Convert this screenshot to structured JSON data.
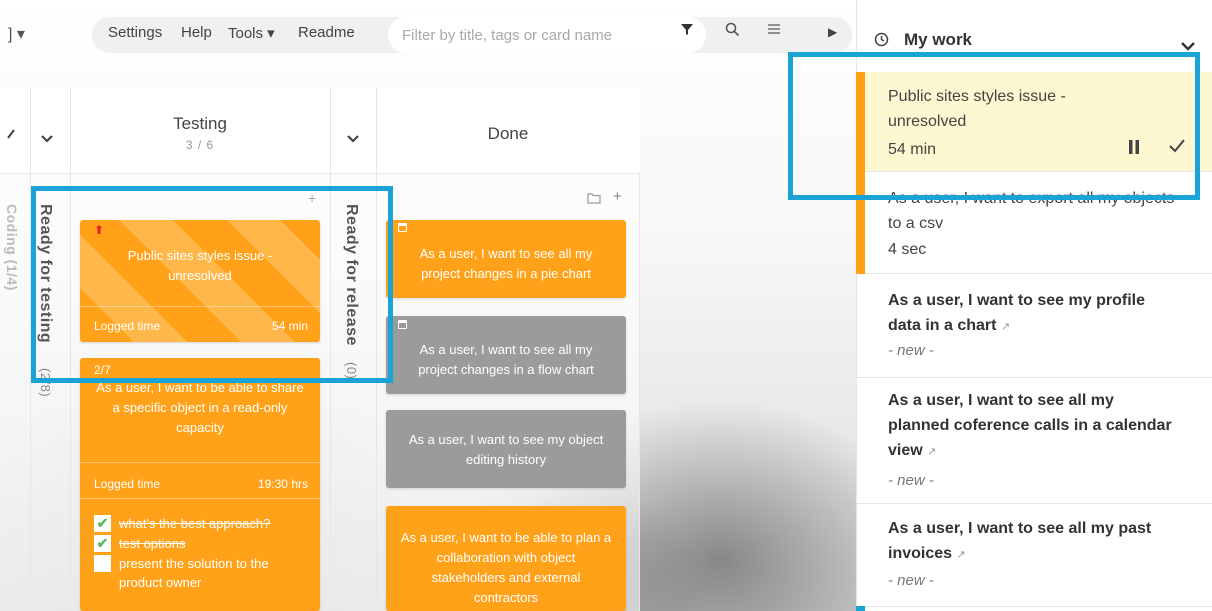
{
  "topbar": {
    "left_fragment": "] ▾",
    "menu": {
      "settings": "Settings",
      "help": "Help",
      "tools": "Tools ▾",
      "readme": "Readme"
    },
    "filter_placeholder": "Filter by title, tags or card name",
    "icons": [
      "filter-icon",
      "search-icon",
      "menu-icon",
      "caret-right-icon"
    ]
  },
  "board": {
    "columns": [
      {
        "title": "Testing",
        "count": "3 / 6"
      },
      {
        "title": "Done",
        "count": ""
      }
    ],
    "lanes": {
      "left_partial": "Coding (1/4)",
      "ready_for_testing": "Ready for testing",
      "ready_for_testing_count": "(2/8)",
      "ready_for_release": "Ready for release",
      "ready_for_release_count": "(0)"
    },
    "testing_cards": [
      {
        "title": "Public sites styles issue - unresolved",
        "logged_label": "Logged time",
        "logged_value": "54 min"
      },
      {
        "badge": "2/7",
        "title": "As a user, I want to be able to share a specific object in a read-only capacity",
        "logged_label": "Logged time",
        "logged_value": "19:30 hrs",
        "checklist": [
          {
            "text": "what's the best approach?",
            "done": true
          },
          {
            "text": "test options",
            "done": true
          },
          {
            "text": "present the solution to the product owner",
            "done": false
          }
        ]
      }
    ],
    "done_cards": [
      {
        "title": "As a user, I want to see all my project changes in a pie chart"
      },
      {
        "title": "As a user, I want to see all my project changes in a flow chart"
      },
      {
        "title": "As a user, I want to see my object editing history"
      },
      {
        "title": "As a user, I want to be able to plan a collaboration with object stakeholders and external contractors"
      }
    ]
  },
  "my_work": {
    "title": "My work",
    "items": [
      {
        "title": "Public sites styles issue - unresolved",
        "time": "54 min",
        "active": true
      },
      {
        "title": "As a user, I want to export all my objects to a csv",
        "time": "4 sec"
      },
      {
        "title": "As a user, I want to see my profile data in a chart",
        "status": "- new -"
      },
      {
        "title": "As a user, I want to see all my planned coference calls in a calendar view",
        "status": "- new -"
      },
      {
        "title": "As a user, I want to see all my past invoices",
        "status": "- new -"
      }
    ]
  },
  "colors": {
    "card_orange": "#ffa21a",
    "card_grey": "#9b9b9b",
    "highlight_blue": "#1aa3d6",
    "active_item_bg": "#fdf8d2"
  }
}
